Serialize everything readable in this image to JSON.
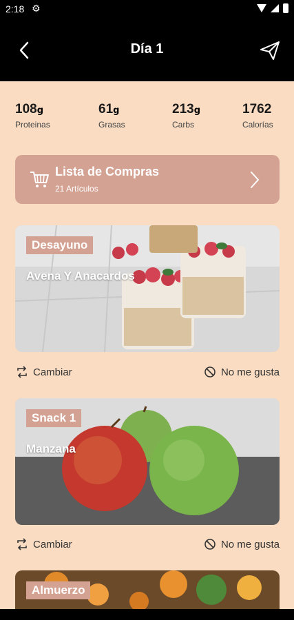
{
  "status_bar": {
    "time": "2:18"
  },
  "header": {
    "title": "Día 1"
  },
  "macros": [
    {
      "value": "108",
      "unit": "g",
      "label": "Proteinas"
    },
    {
      "value": "61",
      "unit": "g",
      "label": "Grasas"
    },
    {
      "value": "213",
      "unit": "g",
      "label": "Carbs"
    },
    {
      "value": "1762",
      "unit": "",
      "label": "Calorías"
    }
  ],
  "shopping_list": {
    "title": "Lista de Compras",
    "subtitle": "21 Artículos"
  },
  "meals": [
    {
      "tag": "Desayuno",
      "name": "Avena Y Anacardos"
    },
    {
      "tag": "Snack 1",
      "name": "Manzana"
    },
    {
      "tag": "Almuerzo",
      "name": ""
    }
  ],
  "actions": {
    "swap_label": "Cambiar",
    "dislike_label": "No me gusta"
  },
  "colors": {
    "accent": "#d4a292",
    "background": "#f9dcc2",
    "header": "#000000"
  }
}
